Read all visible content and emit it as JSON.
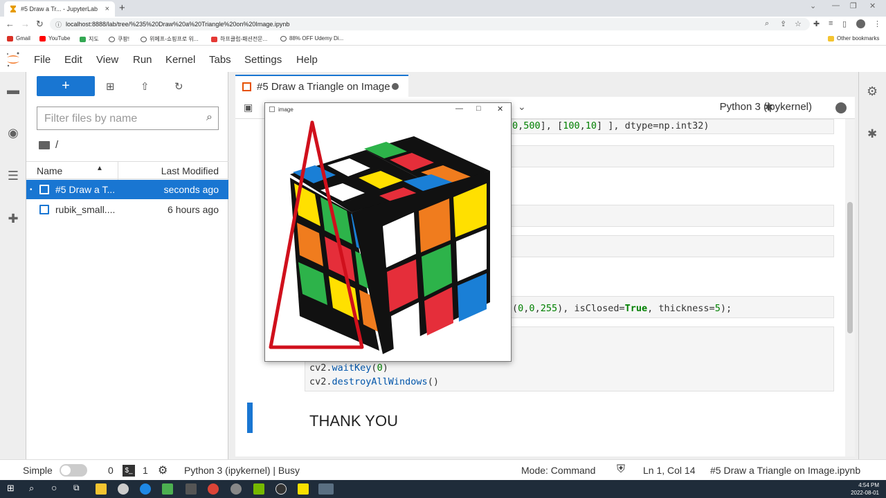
{
  "browser": {
    "tab_title": "#5 Draw a Tr... - JupyterLab",
    "url": "localhost:8888/lab/tree/%235%20Draw%20a%20Triangle%20on%20Image.ipynb",
    "bookmarks": [
      "Gmail",
      "YouTube",
      "지도",
      "쿠팡!",
      "위메프-쇼핑프로 위...",
      "하프클럽-패션전문...",
      "88% OFF Udemy Di..."
    ],
    "other_bookmarks": "Other bookmarks"
  },
  "menu": [
    "File",
    "Edit",
    "View",
    "Run",
    "Kernel",
    "Tabs",
    "Settings",
    "Help"
  ],
  "filebrowser": {
    "filter_placeholder": "Filter files by name",
    "breadcrumb": "/",
    "col_name": "Name",
    "col_modified": "Last Modified",
    "files": [
      {
        "name": "#5 Draw a T...",
        "modified": "seconds ago"
      },
      {
        "name": "rubik_small....",
        "modified": "6 hours ago"
      }
    ]
  },
  "notebook": {
    "tab_title": "#5 Draw a Triangle on Image",
    "kernel": "Python 3 (ipykernel)",
    "code_line_pts_tail": "0,500], [100,10] ], dtype=np.int32)",
    "code_line_polylines_tail": "(0,0,255), isClosed=True, thickness=5);",
    "code_waitkey": "cv2.waitKey(0)",
    "code_destroy": "cv2.destroyAllWindows()",
    "markdown_heading": "THANK YOU"
  },
  "cv_window": {
    "title": "image"
  },
  "status": {
    "mode_label": "Simple",
    "terminals": "0",
    "kernels": "1",
    "kernel_status": "Python 3 (ipykernel) | Busy",
    "mode": "Mode: Command",
    "cursor": "Ln 1, Col 14",
    "filename": "#5 Draw a Triangle on Image.ipynb"
  },
  "taskbar": {
    "time": "4:54 PM",
    "date": "2022-08-01"
  },
  "colors": {
    "jupyter_blue": "#1976d2",
    "triangle_red": "#d0101c",
    "taskbar": "#1f2c3a"
  }
}
